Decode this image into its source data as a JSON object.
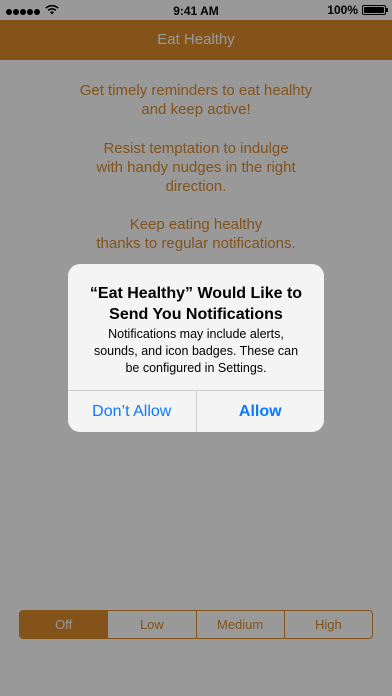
{
  "status_bar": {
    "carrier_signal": "signal-dots",
    "wifi_icon": "wifi-icon",
    "time": "9:41 AM",
    "battery_percent": "100%",
    "battery_level": 1.0
  },
  "nav": {
    "title": "Eat Healthy",
    "bar_color": "#db8b2c"
  },
  "content": {
    "paragraph_1": "Get timely reminders to eat healhty\nand keep active!",
    "paragraph_2": "Resist temptation to indulge\nwith handy nudges in the right\ndirection.",
    "paragraph_3": "Keep eating healthy\nthanks to regular notifications.",
    "text_color": "#d98a2d"
  },
  "segmented_control": {
    "options": [
      "Off",
      "Low",
      "Medium",
      "High"
    ],
    "selected": "Off"
  },
  "alert": {
    "title": "“Eat Healthy” Would Like to\nSend You Notifications",
    "message": "Notifications may include alerts,\nsounds, and icon badges. These can\nbe configured in Settings.",
    "deny_label": "Don’t Allow",
    "allow_label": "Allow",
    "button_color": "#0a7aff"
  }
}
